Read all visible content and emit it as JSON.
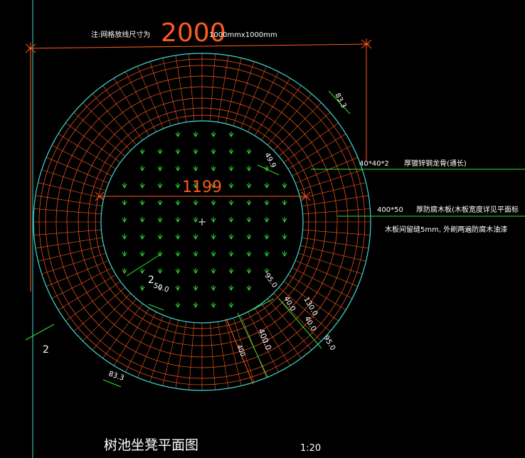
{
  "drawing": {
    "note_label": "注:网格放线尺寸为",
    "note_grid": "1000mmx1000mm",
    "overall_dim": "2000",
    "inner_dim": "1199",
    "title": "树池坐凳平面图",
    "scale": "1:20"
  },
  "annotations": {
    "steel": {
      "size": "40*40*2",
      "desc": "厚镀锌钢龙骨(通长)"
    },
    "plank": {
      "size": "400*50",
      "desc": "厚防腐木板(木板宽度详见平面标"
    },
    "gap_note": "木板间留缝5mm, 外刷两遍防腐木油漆"
  },
  "dimensions": {
    "d_83_top": "83.3",
    "d_83_bot": "83.3",
    "d_499": "49.9",
    "d_95_a": "95.0",
    "d_40_a": "40.0",
    "d_130": "130.0",
    "d_40_b": "40.0",
    "d_95_b": "95.0",
    "d_400_a": "400.0",
    "d_400_b": "400",
    "d_50": "50.0",
    "sec_2_a": "2",
    "sec_2_b": "2"
  },
  "colors": {
    "background": "#000000",
    "cyan": "#3fd9d2",
    "orange": "#ff5a1e",
    "green": "#2fe32f",
    "white": "#ffffff"
  }
}
